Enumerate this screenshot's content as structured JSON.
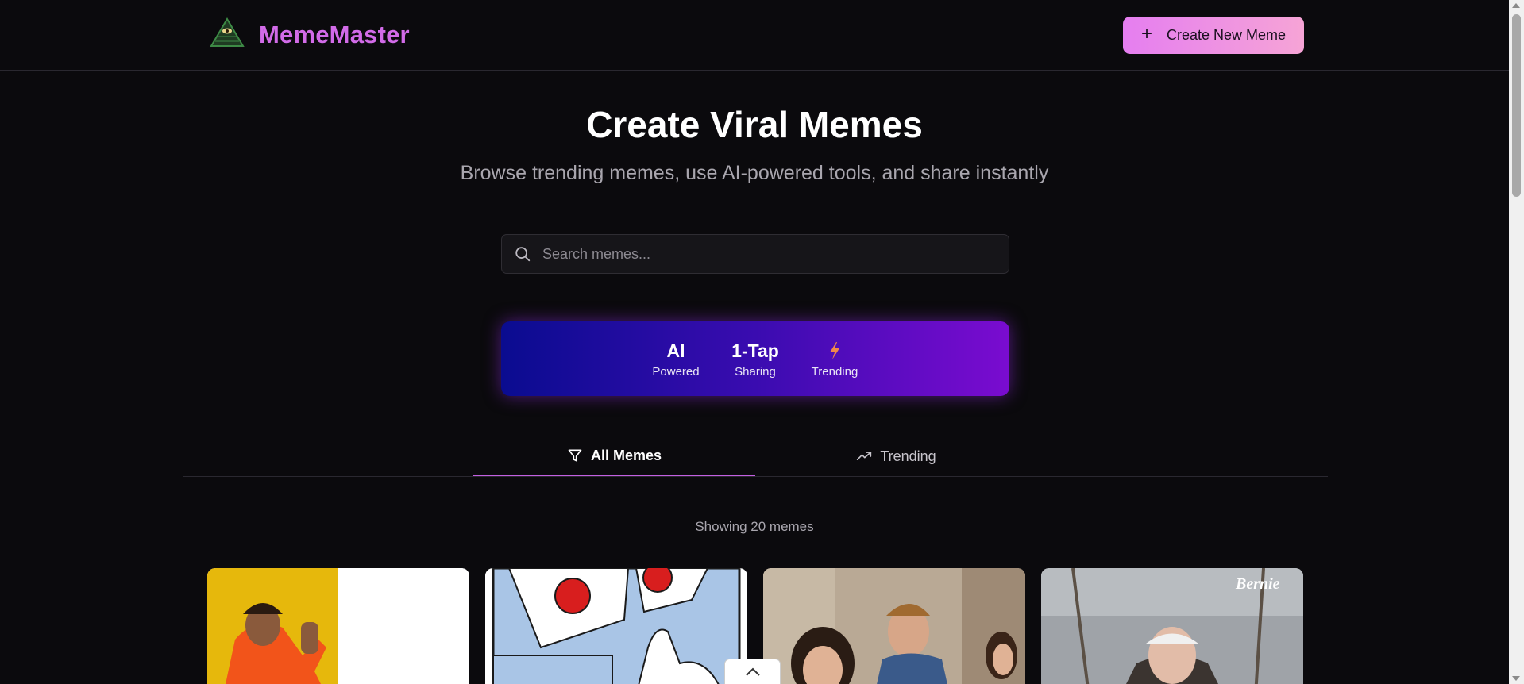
{
  "header": {
    "brand": "MemeMaster",
    "logo_icon": "illuminati-triangle-icon",
    "create_button_label": "Create New Meme"
  },
  "hero": {
    "title": "Create Viral Memes",
    "subtitle": "Browse trending memes, use AI-powered tools, and share instantly"
  },
  "search": {
    "placeholder": "Search memes...",
    "value": ""
  },
  "features": [
    {
      "big": "AI",
      "small": "Powered"
    },
    {
      "big": "1-Tap",
      "small": "Sharing"
    },
    {
      "big": "",
      "icon": "lightning-icon",
      "small": "Trending"
    }
  ],
  "tabs": [
    {
      "label": "All Memes",
      "icon": "filter-icon",
      "active": true
    },
    {
      "label": "Trending",
      "icon": "trending-up-icon",
      "active": false
    }
  ],
  "results": {
    "count_text": "Showing 20 memes"
  },
  "memes": [
    {
      "name": "drake-meme"
    },
    {
      "name": "two-buttons-meme"
    },
    {
      "name": "distracted-boyfriend-meme"
    },
    {
      "name": "bernie-meme",
      "caption": "Bernie"
    }
  ],
  "colors": {
    "background": "#0b0a0d",
    "brand": "#d26be8",
    "accent_gradient_start": "#e57ef0",
    "accent_gradient_end": "#f6a4d6",
    "tab_active": "#c35fe0"
  }
}
